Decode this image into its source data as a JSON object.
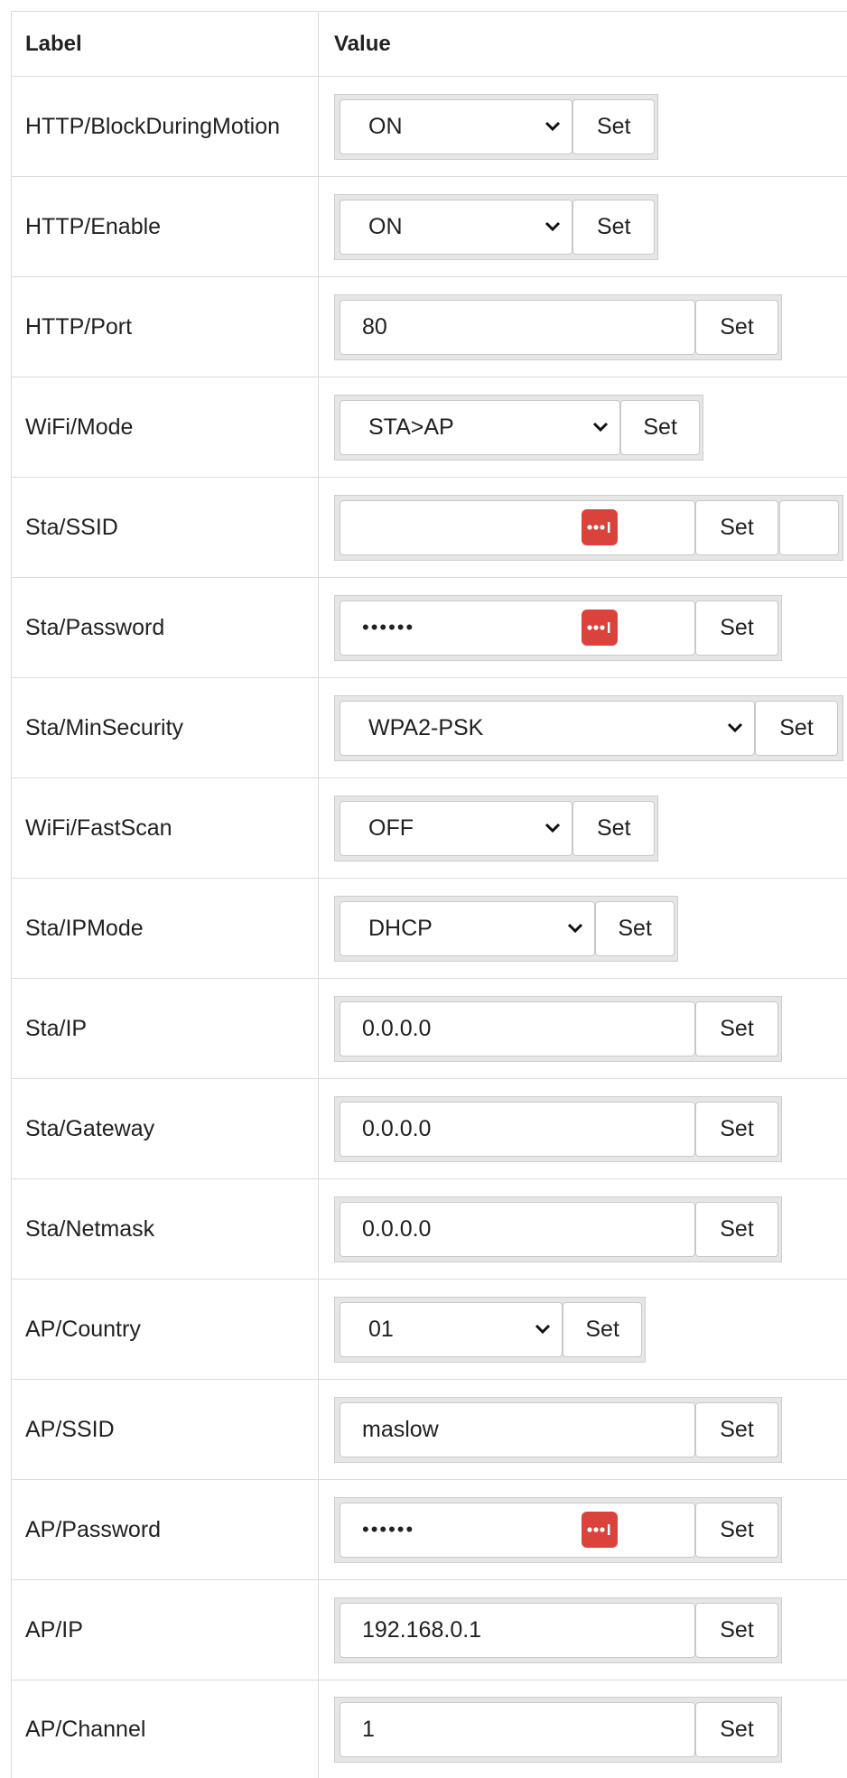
{
  "table": {
    "header": {
      "label": "Label",
      "value": "Value"
    },
    "rows": [
      {
        "label": "HTTP/BlockDuringMotion",
        "type": "select",
        "value": "ON",
        "button": "Set"
      },
      {
        "label": "HTTP/Enable",
        "type": "select",
        "value": "ON",
        "button": "Set"
      },
      {
        "label": "HTTP/Port",
        "type": "input",
        "value": "80",
        "button": "Set"
      },
      {
        "label": "WiFi/Mode",
        "type": "select",
        "value": "STA>AP",
        "button": "Set"
      },
      {
        "label": "Sta/SSID",
        "type": "input",
        "value": "",
        "button": "Set"
      },
      {
        "label": "Sta/Password",
        "type": "password",
        "value": "••••••",
        "button": "Set"
      },
      {
        "label": "Sta/MinSecurity",
        "type": "select",
        "value": "WPA2-PSK",
        "button": "Set"
      },
      {
        "label": "WiFi/FastScan",
        "type": "select",
        "value": "OFF",
        "button": "Set"
      },
      {
        "label": "Sta/IPMode",
        "type": "select",
        "value": "DHCP",
        "button": "Set"
      },
      {
        "label": "Sta/IP",
        "type": "input",
        "value": "0.0.0.0",
        "button": "Set"
      },
      {
        "label": "Sta/Gateway",
        "type": "input",
        "value": "0.0.0.0",
        "button": "Set"
      },
      {
        "label": "Sta/Netmask",
        "type": "input",
        "value": "0.0.0.0",
        "button": "Set"
      },
      {
        "label": "AP/Country",
        "type": "select",
        "value": "01",
        "button": "Set"
      },
      {
        "label": "AP/SSID",
        "type": "input",
        "value": "maslow",
        "button": "Set"
      },
      {
        "label": "AP/Password",
        "type": "password",
        "value": "••••••",
        "button": "Set"
      },
      {
        "label": "AP/IP",
        "type": "input",
        "value": "192.168.0.1",
        "button": "Set"
      },
      {
        "label": "AP/Channel",
        "type": "input",
        "value": "1",
        "button": "Set"
      }
    ]
  },
  "colors": {
    "password_icon": "#d9433b",
    "border": "#dcdcdc",
    "group_bg": "#e6e6e6"
  },
  "icons": {
    "select_arrow": "chevron-down-icon",
    "password_manager": "password-manager-icon"
  }
}
